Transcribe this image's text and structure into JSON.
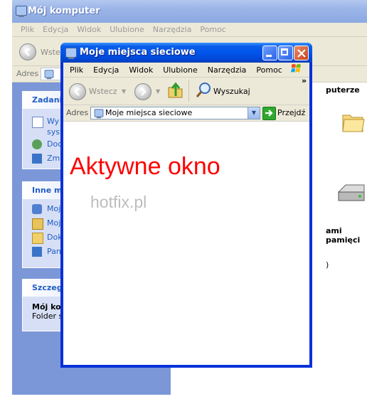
{
  "background_window": {
    "title": "Mój komputer",
    "menu": [
      "Plik",
      "Edycja",
      "Widok",
      "Ulubione",
      "Narzędzia",
      "Pomoc"
    ],
    "back_label": "Wstecz",
    "address_label": "Adres",
    "task_panels": [
      {
        "title": "Zadania",
        "items": [
          "Wy",
          "syst",
          "Doc",
          "Zmi"
        ]
      },
      {
        "title": "Inne m",
        "items": [
          "Moj",
          "Moj",
          "Dok",
          "Pan"
        ]
      },
      {
        "title": "Szczegó",
        "items": [
          "Mój kon",
          "Folder sy"
        ]
      }
    ],
    "right_fragments": {
      "heading": "puterze",
      "drive_label": "ami pamięci",
      "paren": ")"
    }
  },
  "active_window": {
    "title": "Moje miejsca sieciowe",
    "menu": [
      "Plik",
      "Edycja",
      "Widok",
      "Ulubione",
      "Narzędzia",
      "Pomoc"
    ],
    "back_label": "Wstecz",
    "search_label": "Wyszukaj",
    "address_label": "Adres",
    "address_value": "Moje miejsca sieciowe",
    "go_label": "Przejdź",
    "chevron": "»"
  },
  "overlay": {
    "text": "Aktywne okno",
    "watermark": "hotfix.pl"
  },
  "colors": {
    "title_active": "#0055ea",
    "title_inactive": "#9bb5e8",
    "overlay_text": "#ff0000",
    "task_header": "#215dc6"
  }
}
